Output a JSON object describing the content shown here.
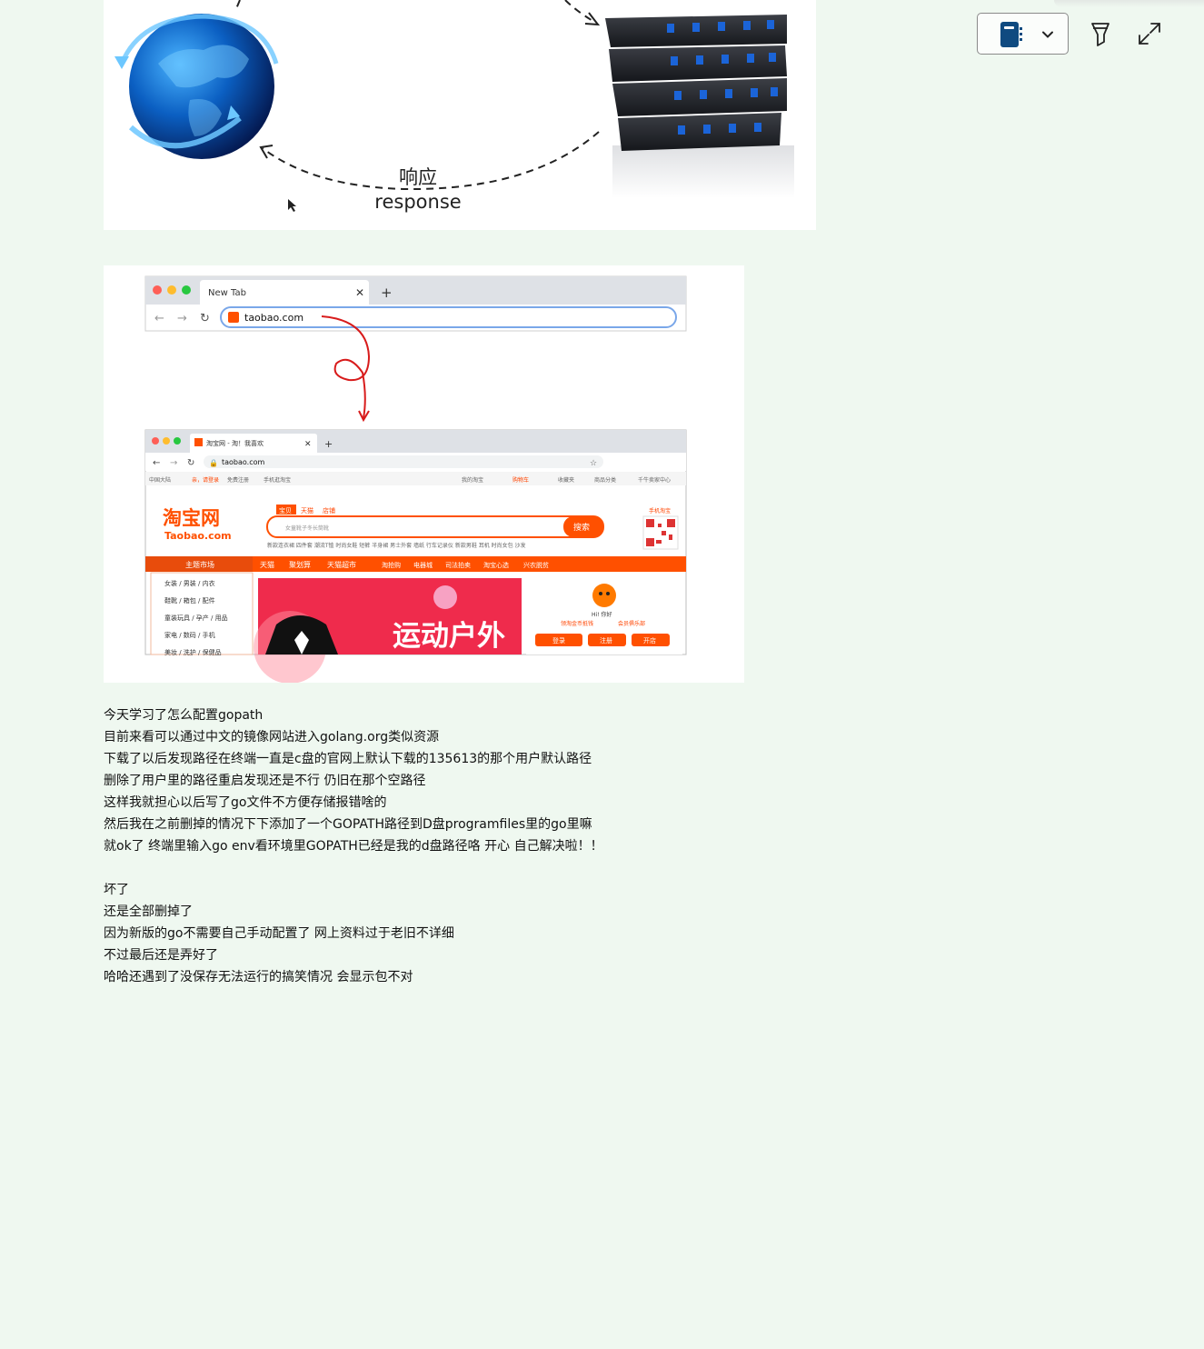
{
  "toolbar": {
    "notebook_icon": "notebook-icon",
    "dropdown_icon": "chevron-down-icon",
    "highlighter_icon": "highlighter-icon",
    "expand_icon": "expand-icon"
  },
  "figure1": {
    "label_cn": "响应",
    "label_en": "response"
  },
  "figure2": {
    "tab_new": "New Tab",
    "address_typed": "taobao.com",
    "tab_taobao": "淘宝网 - 淘！我喜欢",
    "address_loaded": "taobao.com",
    "top_links_left": [
      "中国大陆",
      "亲，请登录",
      "免费注册",
      "手机逛淘宝"
    ],
    "top_links_right": [
      "我的淘宝",
      "购物车",
      "收藏夹",
      "商品分类",
      "千牛卖家中心"
    ],
    "logo_cn": "淘宝网",
    "logo_en": "Taobao.com",
    "search_tabs": [
      "宝贝",
      "天猫",
      "店铺"
    ],
    "search_placeholder": "女童靴子冬长筒靴",
    "search_button": "搜索",
    "hot_words": "新款连衣裙 四件套 潮流T恤 时尚女鞋 短裤 半身裙 男士外套 墙纸 行车记录仪 新款男鞋 耳机 时尚女包 沙发",
    "qr_label": "手机淘宝",
    "nav_main": "主题市场",
    "nav_items": [
      "天猫",
      "聚划算",
      "天猫超市",
      "淘抢购",
      "电器城",
      "司法拍卖",
      "淘宝心选",
      "兴农脱贫"
    ],
    "categories": [
      "女装 / 男装 / 内衣",
      "鞋靴 / 箱包 / 配件",
      "童装玩具 / 孕产 / 用品",
      "家电 / 数码 / 手机",
      "美妆 / 洗护 / 保健品"
    ],
    "banner_text": "运动户外",
    "greeting": "Hi! 你好",
    "member_links": [
      "领淘金币抵钱",
      "会员俱乐部"
    ],
    "member_buttons": [
      "登录",
      "注册",
      "开店"
    ]
  },
  "notes": {
    "lines": [
      "今天学习了怎么配置gopath",
      "目前来看可以通过中文的镜像网站进入golang.org类似资源",
      "下载了以后发现路径在终端一直是c盘的官网上默认下载的135613的那个用户默认路径",
      "删除了用户里的路径重启发现还是不行 仍旧在那个空路径",
      "这样我就担心以后写了go文件不方便存储报错啥的",
      "然后我在之前删掉的情况下下添加了一个GOPATH路径到D盘programfiles里的go里嘛",
      "就ok了 终端里输入go env看环境里GOPATH已经是我的d盘路径咯 开心 自己解决啦！！"
    ],
    "lines2": [
      "坏了",
      "还是全部删掉了",
      "因为新版的go不需要自己手动配置了 网上资料过于老旧不详细",
      "不过最后还是弄好了",
      "哈哈还遇到了没保存无法运行的搞笑情况 会显示包不对"
    ]
  }
}
